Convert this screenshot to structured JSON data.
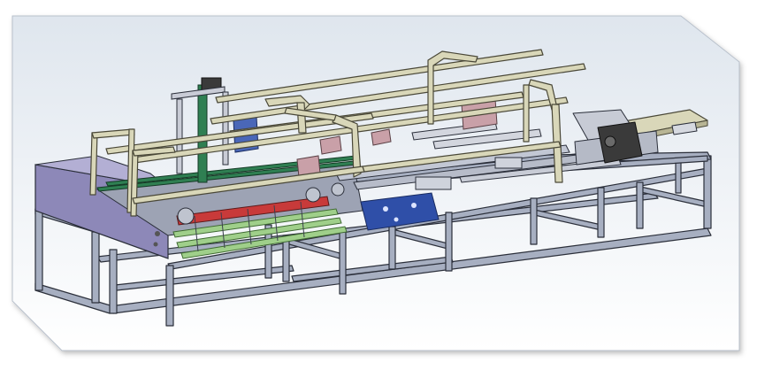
{
  "figure": {
    "kind": "3D CAD render of an industrial machine frame (conveyor / folding unit)",
    "has_text": false
  },
  "colors": {
    "background": "#ffffff",
    "viewport_top": "#dfe6ee",
    "viewport_bottom": "#ffffff",
    "frame_steel": "#a7afc1",
    "frame_edge": "#2b2f3a",
    "side_panel": "#8d88b8",
    "upper_rails": "#d9d7b9",
    "roller_red": "#c83a3a",
    "roller_green": "#9fcf8a",
    "blue_assembly": "#2f4fa8",
    "green_column": "#2f7f52",
    "motor_block": "#3a3a3a",
    "pink_plates": "#c9a0a8"
  }
}
